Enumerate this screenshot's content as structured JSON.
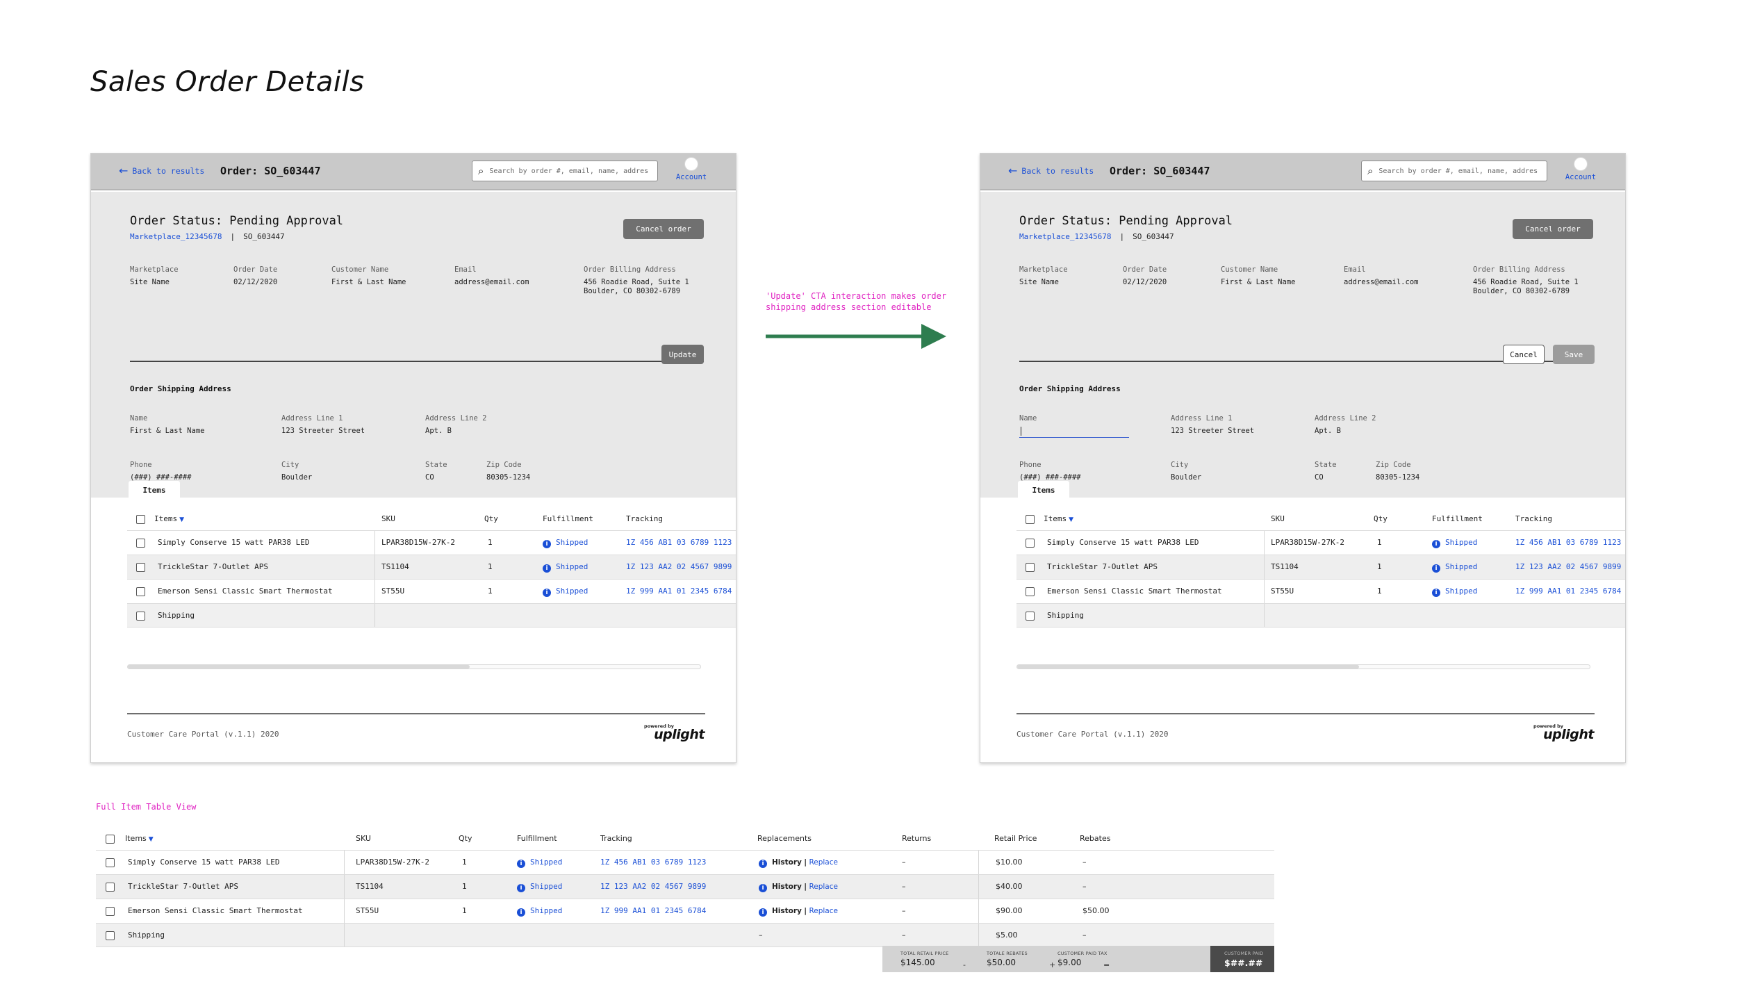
{
  "page": {
    "title": "Sales Order Details"
  },
  "header": {
    "back_label": "Back to results",
    "order_title": "Order: SO_603447",
    "search_placeholder": "Search by order #, email, name, address",
    "account_label": "Account"
  },
  "order": {
    "status": "Order Status: Pending Approval",
    "marketplace_id": "Marketplace_12345678",
    "separator": "|",
    "order_id": "SO_603447",
    "cancel_order_label": "Cancel order",
    "info": [
      {
        "label": "Marketplace",
        "value": "Site Name"
      },
      {
        "label": "Order Date",
        "value": "02/12/2020"
      },
      {
        "label": "Customer Name",
        "value": "First & Last Name"
      },
      {
        "label": "Email",
        "value": "address@email.com"
      },
      {
        "label": "Order Billing Address",
        "value_line1": "456 Roadie Road, Suite 1",
        "value_line2": "Boulder, CO 80302-6789"
      }
    ]
  },
  "shipping": {
    "title": "Order Shipping Address",
    "update_label": "Update",
    "cancel_label": "Cancel",
    "save_label": "Save",
    "name_label": "Name",
    "name_value": "First & Last Name",
    "address1_label": "Address Line 1",
    "address1_value": "123 Streeter Street",
    "address2_label": "Address Line 2",
    "address2_value": "Apt. B",
    "phone_label": "Phone",
    "phone_value": "(###) ###-####",
    "city_label": "City",
    "city_value": "Boulder",
    "state_label": "State",
    "state_value": "CO",
    "zip_label": "Zip Code",
    "zip_value": "80305-1234"
  },
  "items_tab": "Items",
  "table": {
    "headers": {
      "items": "Items",
      "sku": "SKU",
      "qty": "Qty",
      "fulfillment": "Fulfillment",
      "tracking": "Tracking",
      "replacements": "Replacements",
      "returns": "Returns",
      "retail_price": "Retail Price",
      "rebates": "Rebates"
    },
    "rows": [
      {
        "item": "Simply Conserve 15 watt PAR38 LED",
        "sku": "LPAR38D15W-27K-2",
        "qty": "1",
        "fulfillment": "Shipped",
        "tracking": "1Z 456 AB1 03 6789 1123",
        "history": "History",
        "pipe": "|",
        "replace": "Replace",
        "returns": "–",
        "price": "$10.00",
        "rebates": "–"
      },
      {
        "item": "TrickleStar 7-Outlet APS",
        "sku": "TS1104",
        "qty": "1",
        "fulfillment": "Shipped",
        "tracking": "1Z 123 AA2 02 4567 9899",
        "history": "History",
        "pipe": "|",
        "replace": "Replace",
        "returns": "–",
        "price": "$40.00",
        "rebates": "–"
      },
      {
        "item": "Emerson Sensi Classic Smart Thermostat",
        "sku": "ST55U",
        "qty": "1",
        "fulfillment": "Shipped",
        "tracking": "1Z 999 AA1 01 2345 6784",
        "history": "History",
        "pipe": "|",
        "replace": "Replace",
        "returns": "–",
        "price": "$90.00",
        "rebates": "$50.00"
      },
      {
        "item": "Shipping",
        "replacements": "–",
        "returns": "–",
        "price": "$5.00",
        "rebates": "–"
      }
    ]
  },
  "footer": {
    "text": "Customer Care Portal (v.1.1) 2020",
    "powered_by": "powered by",
    "brand": "uplight"
  },
  "annotation": {
    "text": "'Update' CTA interaction makes order shipping address section editable",
    "arrow_color": "#2e7d4f"
  },
  "full_table_title": "Full Item Table View",
  "totals": {
    "retail_label": "TOTAL RETAIL PRICE",
    "retail_value": "$145.00",
    "minus": "-",
    "rebates_label": "TOTALE REBATES",
    "rebates_value": "$50.00",
    "plus": "+",
    "tax_label": "CUSTOMER PAID TAX",
    "tax_value": "$9.00",
    "equals": "=",
    "paid_label": "CUSTOMER PAID",
    "paid_value": "$##.##"
  },
  "colors": {
    "accent": "#1a4fd6",
    "annotation": "#e024c2",
    "panel": "#e8e8e8",
    "topbar": "#c9c9c9"
  }
}
